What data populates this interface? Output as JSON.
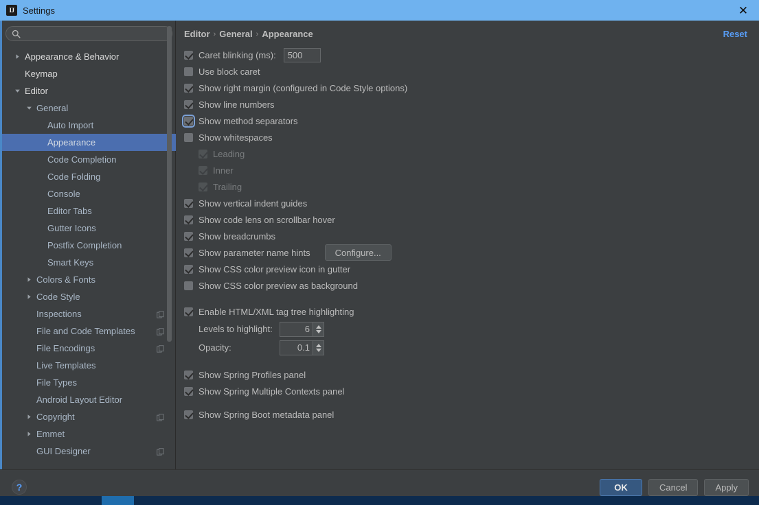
{
  "window": {
    "title": "Settings",
    "icon": "intellij-idea-icon",
    "icon_text": "IJ",
    "close_label": "✕"
  },
  "sidebar": {
    "search": {
      "value": "",
      "placeholder": "",
      "icon": "search-icon"
    },
    "items": [
      {
        "label": "Appearance & Behavior",
        "depth": 0,
        "arrow": "collapsed",
        "bright": true,
        "selected": false,
        "copy_icon": false
      },
      {
        "label": "Keymap",
        "depth": 0,
        "arrow": "none",
        "bright": true,
        "selected": false,
        "copy_icon": false
      },
      {
        "label": "Editor",
        "depth": 0,
        "arrow": "expanded",
        "bright": true,
        "selected": false,
        "copy_icon": false
      },
      {
        "label": "General",
        "depth": 1,
        "arrow": "expanded",
        "bright": false,
        "selected": false,
        "copy_icon": false
      },
      {
        "label": "Auto Import",
        "depth": 2,
        "arrow": "none",
        "bright": false,
        "selected": false,
        "copy_icon": false
      },
      {
        "label": "Appearance",
        "depth": 2,
        "arrow": "none",
        "bright": false,
        "selected": true,
        "copy_icon": false
      },
      {
        "label": "Code Completion",
        "depth": 2,
        "arrow": "none",
        "bright": false,
        "selected": false,
        "copy_icon": false
      },
      {
        "label": "Code Folding",
        "depth": 2,
        "arrow": "none",
        "bright": false,
        "selected": false,
        "copy_icon": false
      },
      {
        "label": "Console",
        "depth": 2,
        "arrow": "none",
        "bright": false,
        "selected": false,
        "copy_icon": false
      },
      {
        "label": "Editor Tabs",
        "depth": 2,
        "arrow": "none",
        "bright": false,
        "selected": false,
        "copy_icon": false
      },
      {
        "label": "Gutter Icons",
        "depth": 2,
        "arrow": "none",
        "bright": false,
        "selected": false,
        "copy_icon": false
      },
      {
        "label": "Postfix Completion",
        "depth": 2,
        "arrow": "none",
        "bright": false,
        "selected": false,
        "copy_icon": false
      },
      {
        "label": "Smart Keys",
        "depth": 2,
        "arrow": "none",
        "bright": false,
        "selected": false,
        "copy_icon": false
      },
      {
        "label": "Colors & Fonts",
        "depth": 1,
        "arrow": "collapsed",
        "bright": false,
        "selected": false,
        "copy_icon": false
      },
      {
        "label": "Code Style",
        "depth": 1,
        "arrow": "collapsed",
        "bright": false,
        "selected": false,
        "copy_icon": false
      },
      {
        "label": "Inspections",
        "depth": 1,
        "arrow": "none",
        "bright": false,
        "selected": false,
        "copy_icon": true
      },
      {
        "label": "File and Code Templates",
        "depth": 1,
        "arrow": "none",
        "bright": false,
        "selected": false,
        "copy_icon": true
      },
      {
        "label": "File Encodings",
        "depth": 1,
        "arrow": "none",
        "bright": false,
        "selected": false,
        "copy_icon": true
      },
      {
        "label": "Live Templates",
        "depth": 1,
        "arrow": "none",
        "bright": false,
        "selected": false,
        "copy_icon": false
      },
      {
        "label": "File Types",
        "depth": 1,
        "arrow": "none",
        "bright": false,
        "selected": false,
        "copy_icon": false
      },
      {
        "label": "Android Layout Editor",
        "depth": 1,
        "arrow": "none",
        "bright": false,
        "selected": false,
        "copy_icon": false
      },
      {
        "label": "Copyright",
        "depth": 1,
        "arrow": "collapsed",
        "bright": false,
        "selected": false,
        "copy_icon": true
      },
      {
        "label": "Emmet",
        "depth": 1,
        "arrow": "collapsed",
        "bright": false,
        "selected": false,
        "copy_icon": false
      },
      {
        "label": "GUI Designer",
        "depth": 1,
        "arrow": "none",
        "bright": false,
        "selected": false,
        "copy_icon": true
      }
    ]
  },
  "main": {
    "breadcrumb": {
      "parts": [
        "Editor",
        "General",
        "Appearance"
      ],
      "separator": "›"
    },
    "reset_label": "Reset",
    "options": [
      {
        "kind": "checkbox-field",
        "label": "Caret blinking (ms):",
        "checked": true,
        "disabled": false,
        "focused": false,
        "field_value": "500"
      },
      {
        "kind": "checkbox",
        "label": "Use block caret",
        "checked": false,
        "disabled": false,
        "focused": false
      },
      {
        "kind": "checkbox",
        "label": "Show right margin (configured in Code Style options)",
        "checked": true,
        "disabled": false,
        "focused": false
      },
      {
        "kind": "checkbox",
        "label": "Show line numbers",
        "checked": true,
        "disabled": false,
        "focused": false
      },
      {
        "kind": "checkbox",
        "label": "Show method separators",
        "checked": true,
        "disabled": false,
        "focused": true
      },
      {
        "kind": "checkbox",
        "label": "Show whitespaces",
        "checked": false,
        "disabled": false,
        "focused": false
      },
      {
        "kind": "checkbox",
        "label": "Leading",
        "checked": true,
        "disabled": true,
        "focused": false,
        "indent": true
      },
      {
        "kind": "checkbox",
        "label": "Inner",
        "checked": true,
        "disabled": true,
        "focused": false,
        "indent": true
      },
      {
        "kind": "checkbox",
        "label": "Trailing",
        "checked": true,
        "disabled": true,
        "focused": false,
        "indent": true
      },
      {
        "kind": "checkbox",
        "label": "Show vertical indent guides",
        "checked": true,
        "disabled": false,
        "focused": false
      },
      {
        "kind": "checkbox",
        "label": "Show code lens on scrollbar hover",
        "checked": true,
        "disabled": false,
        "focused": false
      },
      {
        "kind": "checkbox",
        "label": "Show breadcrumbs",
        "checked": true,
        "disabled": false,
        "focused": false
      },
      {
        "kind": "checkbox-button",
        "label": "Show parameter name hints",
        "checked": true,
        "disabled": false,
        "focused": false,
        "button_label": "Configure..."
      },
      {
        "kind": "checkbox",
        "label": "Show CSS color preview icon in gutter",
        "checked": true,
        "disabled": false,
        "focused": false
      },
      {
        "kind": "checkbox",
        "label": "Show CSS color preview as background",
        "checked": false,
        "disabled": false,
        "focused": false
      },
      {
        "kind": "gap"
      },
      {
        "kind": "checkbox",
        "label": "Enable HTML/XML tag tree highlighting",
        "checked": true,
        "disabled": false,
        "focused": false
      },
      {
        "kind": "spinner",
        "label": "Levels to highlight:",
        "value": "6"
      },
      {
        "kind": "spinner",
        "label": "Opacity:",
        "value": "0.1"
      },
      {
        "kind": "gap"
      },
      {
        "kind": "checkbox",
        "label": "Show Spring Profiles panel",
        "checked": true,
        "disabled": false,
        "focused": false
      },
      {
        "kind": "checkbox",
        "label": "Show Spring Multiple Contexts panel",
        "checked": true,
        "disabled": false,
        "focused": false
      },
      {
        "kind": "gap-small"
      },
      {
        "kind": "checkbox",
        "label": "Show Spring Boot metadata panel",
        "checked": true,
        "disabled": false,
        "focused": false
      }
    ]
  },
  "footer": {
    "help_label": "?",
    "buttons": [
      {
        "label": "OK",
        "primary": true
      },
      {
        "label": "Cancel",
        "primary": false
      },
      {
        "label": "Apply",
        "primary": false
      }
    ]
  },
  "colors": {
    "titlebar": "#6fb2ef",
    "panel_bg": "#3c3f41",
    "selection": "#4b6eaf",
    "link": "#589df6",
    "primary_button": "#365880",
    "text": "#bbbbbb",
    "taskbar": "#0d2b4e"
  }
}
